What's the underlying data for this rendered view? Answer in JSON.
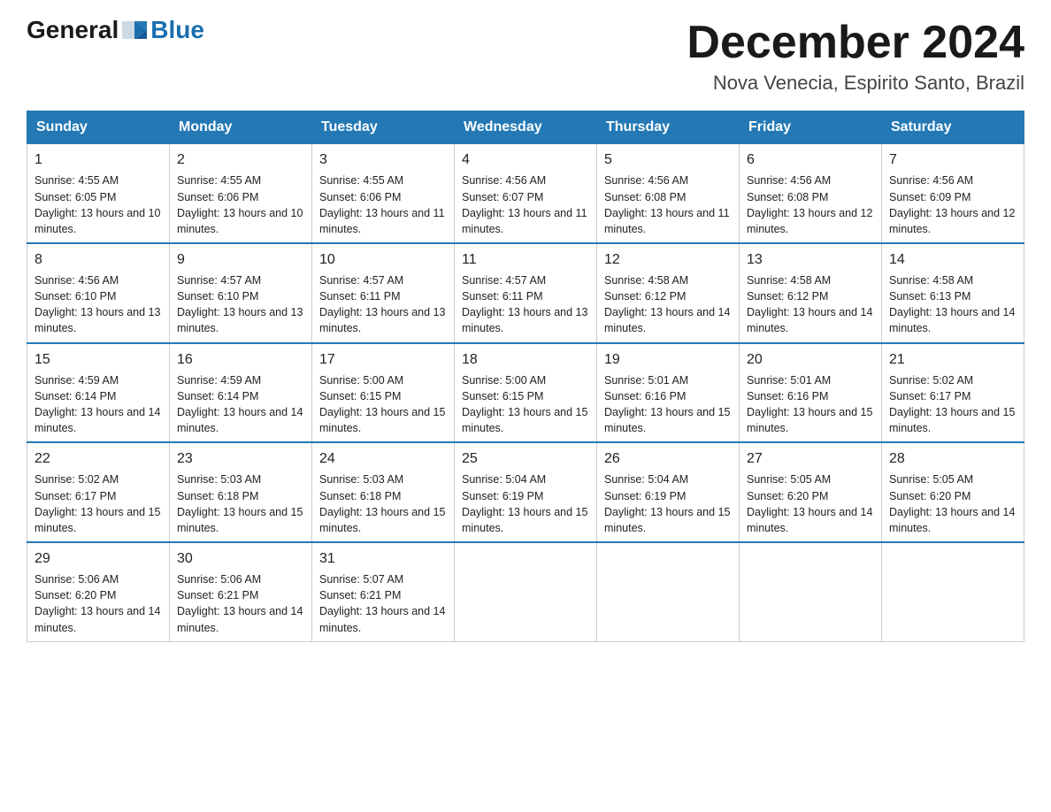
{
  "header": {
    "logo_general": "General",
    "logo_blue": "Blue",
    "month_title": "December 2024",
    "location": "Nova Venecia, Espirito Santo, Brazil"
  },
  "days_of_week": [
    "Sunday",
    "Monday",
    "Tuesday",
    "Wednesday",
    "Thursday",
    "Friday",
    "Saturday"
  ],
  "weeks": [
    [
      {
        "day": 1,
        "sunrise": "4:55 AM",
        "sunset": "6:05 PM",
        "daylight": "13 hours and 10 minutes."
      },
      {
        "day": 2,
        "sunrise": "4:55 AM",
        "sunset": "6:06 PM",
        "daylight": "13 hours and 10 minutes."
      },
      {
        "day": 3,
        "sunrise": "4:55 AM",
        "sunset": "6:06 PM",
        "daylight": "13 hours and 11 minutes."
      },
      {
        "day": 4,
        "sunrise": "4:56 AM",
        "sunset": "6:07 PM",
        "daylight": "13 hours and 11 minutes."
      },
      {
        "day": 5,
        "sunrise": "4:56 AM",
        "sunset": "6:08 PM",
        "daylight": "13 hours and 11 minutes."
      },
      {
        "day": 6,
        "sunrise": "4:56 AM",
        "sunset": "6:08 PM",
        "daylight": "13 hours and 12 minutes."
      },
      {
        "day": 7,
        "sunrise": "4:56 AM",
        "sunset": "6:09 PM",
        "daylight": "13 hours and 12 minutes."
      }
    ],
    [
      {
        "day": 8,
        "sunrise": "4:56 AM",
        "sunset": "6:10 PM",
        "daylight": "13 hours and 13 minutes."
      },
      {
        "day": 9,
        "sunrise": "4:57 AM",
        "sunset": "6:10 PM",
        "daylight": "13 hours and 13 minutes."
      },
      {
        "day": 10,
        "sunrise": "4:57 AM",
        "sunset": "6:11 PM",
        "daylight": "13 hours and 13 minutes."
      },
      {
        "day": 11,
        "sunrise": "4:57 AM",
        "sunset": "6:11 PM",
        "daylight": "13 hours and 13 minutes."
      },
      {
        "day": 12,
        "sunrise": "4:58 AM",
        "sunset": "6:12 PM",
        "daylight": "13 hours and 14 minutes."
      },
      {
        "day": 13,
        "sunrise": "4:58 AM",
        "sunset": "6:12 PM",
        "daylight": "13 hours and 14 minutes."
      },
      {
        "day": 14,
        "sunrise": "4:58 AM",
        "sunset": "6:13 PM",
        "daylight": "13 hours and 14 minutes."
      }
    ],
    [
      {
        "day": 15,
        "sunrise": "4:59 AM",
        "sunset": "6:14 PM",
        "daylight": "13 hours and 14 minutes."
      },
      {
        "day": 16,
        "sunrise": "4:59 AM",
        "sunset": "6:14 PM",
        "daylight": "13 hours and 14 minutes."
      },
      {
        "day": 17,
        "sunrise": "5:00 AM",
        "sunset": "6:15 PM",
        "daylight": "13 hours and 15 minutes."
      },
      {
        "day": 18,
        "sunrise": "5:00 AM",
        "sunset": "6:15 PM",
        "daylight": "13 hours and 15 minutes."
      },
      {
        "day": 19,
        "sunrise": "5:01 AM",
        "sunset": "6:16 PM",
        "daylight": "13 hours and 15 minutes."
      },
      {
        "day": 20,
        "sunrise": "5:01 AM",
        "sunset": "6:16 PM",
        "daylight": "13 hours and 15 minutes."
      },
      {
        "day": 21,
        "sunrise": "5:02 AM",
        "sunset": "6:17 PM",
        "daylight": "13 hours and 15 minutes."
      }
    ],
    [
      {
        "day": 22,
        "sunrise": "5:02 AM",
        "sunset": "6:17 PM",
        "daylight": "13 hours and 15 minutes."
      },
      {
        "day": 23,
        "sunrise": "5:03 AM",
        "sunset": "6:18 PM",
        "daylight": "13 hours and 15 minutes."
      },
      {
        "day": 24,
        "sunrise": "5:03 AM",
        "sunset": "6:18 PM",
        "daylight": "13 hours and 15 minutes."
      },
      {
        "day": 25,
        "sunrise": "5:04 AM",
        "sunset": "6:19 PM",
        "daylight": "13 hours and 15 minutes."
      },
      {
        "day": 26,
        "sunrise": "5:04 AM",
        "sunset": "6:19 PM",
        "daylight": "13 hours and 15 minutes."
      },
      {
        "day": 27,
        "sunrise": "5:05 AM",
        "sunset": "6:20 PM",
        "daylight": "13 hours and 14 minutes."
      },
      {
        "day": 28,
        "sunrise": "5:05 AM",
        "sunset": "6:20 PM",
        "daylight": "13 hours and 14 minutes."
      }
    ],
    [
      {
        "day": 29,
        "sunrise": "5:06 AM",
        "sunset": "6:20 PM",
        "daylight": "13 hours and 14 minutes."
      },
      {
        "day": 30,
        "sunrise": "5:06 AM",
        "sunset": "6:21 PM",
        "daylight": "13 hours and 14 minutes."
      },
      {
        "day": 31,
        "sunrise": "5:07 AM",
        "sunset": "6:21 PM",
        "daylight": "13 hours and 14 minutes."
      },
      null,
      null,
      null,
      null
    ]
  ]
}
